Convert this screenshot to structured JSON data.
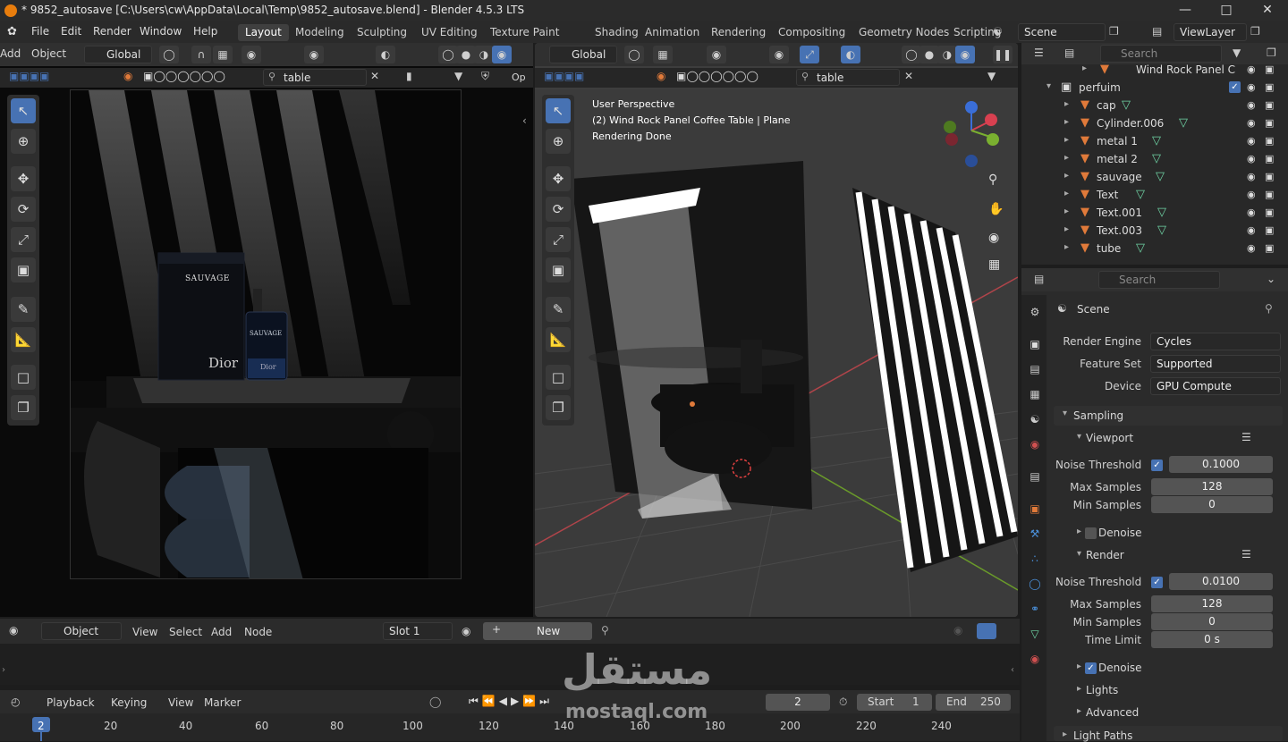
{
  "window": {
    "title": "* 9852_autosave [C:\\Users\\cw\\AppData\\Local\\Temp\\9852_autosave.blend] - Blender 4.5.3 LTS"
  },
  "menu": [
    "File",
    "Edit",
    "Render",
    "Window",
    "Help"
  ],
  "workspaces": [
    "Layout",
    "Modeling",
    "Sculpting",
    "UV Editing",
    "Texture Paint",
    "Shading",
    "Animation",
    "Rendering",
    "Compositing",
    "Geometry Nodes",
    "Scripting"
  ],
  "scene_field": "Scene",
  "viewlayer_field": "ViewLayer",
  "left_view": {
    "add": "Add",
    "object": "Object",
    "orientation": "Global",
    "search": "table",
    "options": "Op"
  },
  "right_view": {
    "orientation": "Global",
    "search": "table",
    "overlay_line1": "User Perspective",
    "overlay_line2": "(2) Wind Rock Panel Coffee Table | Plane",
    "overlay_line3": "Rendering Done"
  },
  "render_text": {
    "box_label": "SAUVAGE",
    "bottle_label": "SAUVAGE",
    "brand": "Dior"
  },
  "outliner": {
    "search_placeholder": "Search",
    "top_item": "Wind Rock Panel C",
    "collection": "perfuim",
    "items": [
      "cap",
      "Cylinder.006",
      "metal 1",
      "metal 2",
      "sauvage",
      "Text",
      "Text.001",
      "Text.003",
      "tube"
    ]
  },
  "properties": {
    "search_placeholder": "Search",
    "context": "Scene",
    "render_engine_label": "Render Engine",
    "render_engine": "Cycles",
    "feature_set_label": "Feature Set",
    "feature_set": "Supported",
    "device_label": "Device",
    "device": "GPU Compute",
    "sampling": "Sampling",
    "viewport": {
      "title": "Viewport",
      "noise_label": "Noise Threshold",
      "noise": "0.1000",
      "max_label": "Max Samples",
      "max": "128",
      "min_label": "Min Samples",
      "min": "0",
      "denoise": "Denoise"
    },
    "render": {
      "title": "Render",
      "noise_label": "Noise Threshold",
      "noise": "0.0100",
      "max_label": "Max Samples",
      "max": "128",
      "min_label": "Min Samples",
      "min": "0",
      "time_label": "Time Limit",
      "time": "0 s",
      "denoise": "Denoise"
    },
    "lights": "Lights",
    "advanced": "Advanced",
    "light_paths": "Light Paths"
  },
  "node_editor": {
    "mode": "Object",
    "view": "View",
    "select": "Select",
    "add": "Add",
    "node": "Node",
    "slot": "Slot 1",
    "new": "New"
  },
  "timeline": {
    "playback": "Playback",
    "keying": "Keying",
    "view": "View",
    "marker": "Marker",
    "current_frame": "2",
    "start_label": "Start",
    "start": "1",
    "end_label": "End",
    "end": "250",
    "ruler": [
      "2",
      "20",
      "40",
      "60",
      "80",
      "100",
      "120",
      "140",
      "160",
      "180",
      "200",
      "220",
      "240"
    ]
  },
  "watermark": {
    "arabic": "مستقل",
    "latin": "mostaql.com"
  },
  "colors": {
    "accent": "#4772b3",
    "bg": "#1d1d1d",
    "header": "#303030",
    "selected_frame": "#4772b3"
  }
}
